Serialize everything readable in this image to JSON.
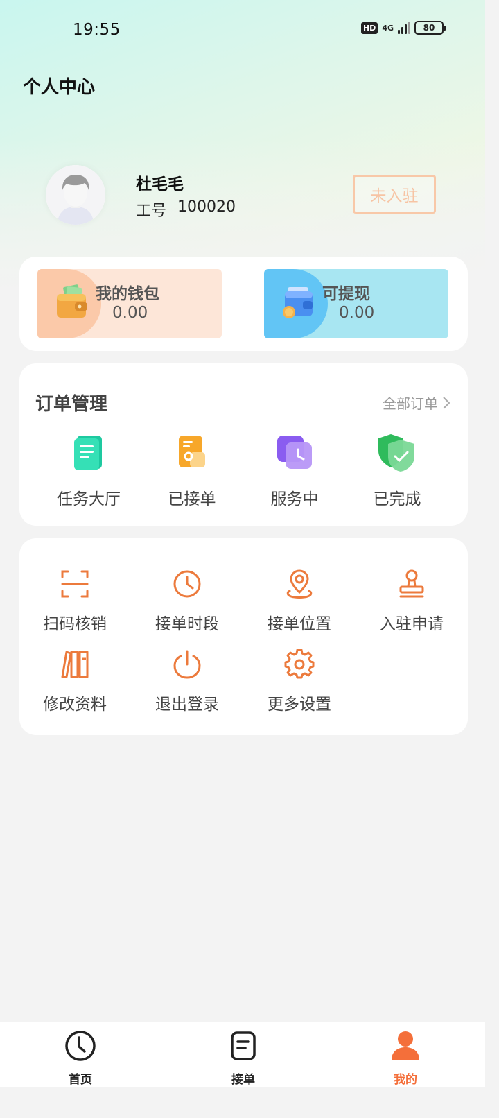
{
  "status_bar": {
    "time": "19:55",
    "hd_badge": "HD",
    "network": "4G",
    "battery": "80"
  },
  "header": {
    "title": "个人中心"
  },
  "profile": {
    "name": "杜毛毛",
    "id_label": "工号",
    "id_value": "100020",
    "status_button": "未入驻",
    "avatar_icon": "person-avatar-icon"
  },
  "wallet": {
    "items": [
      {
        "title": "我的钱包",
        "value": "0.00",
        "icon": "wallet-icon"
      },
      {
        "title": "可提现",
        "value": "0.00",
        "icon": "withdraw-wallet-icon"
      }
    ]
  },
  "orders": {
    "title": "订单管理",
    "all_link": "全部订单",
    "items": [
      {
        "label": "任务大厅",
        "icon": "task-hall-icon"
      },
      {
        "label": "已接单",
        "icon": "accepted-order-icon"
      },
      {
        "label": "服务中",
        "icon": "in-service-icon"
      },
      {
        "label": "已完成",
        "icon": "completed-shield-icon"
      }
    ]
  },
  "tools": {
    "items": [
      {
        "label": "扫码核销",
        "icon": "scan-icon"
      },
      {
        "label": "接单时段",
        "icon": "clock-icon"
      },
      {
        "label": "接单位置",
        "icon": "location-icon"
      },
      {
        "label": "入驻申请",
        "icon": "stamp-icon"
      },
      {
        "label": "修改资料",
        "icon": "books-icon"
      },
      {
        "label": "退出登录",
        "icon": "power-icon"
      },
      {
        "label": "更多设置",
        "icon": "gear-icon"
      }
    ]
  },
  "tabbar": {
    "items": [
      {
        "label": "首页",
        "icon": "clock-home-icon"
      },
      {
        "label": "接单",
        "icon": "order-list-icon"
      },
      {
        "label": "我的",
        "icon": "person-icon"
      }
    ],
    "accent_color": "#f46f3a"
  },
  "colors": {
    "icon_orange": "#ec7a3c",
    "wallet_left_bg": "#fde6d8",
    "wallet_right_bg": "#a8e6f2"
  }
}
